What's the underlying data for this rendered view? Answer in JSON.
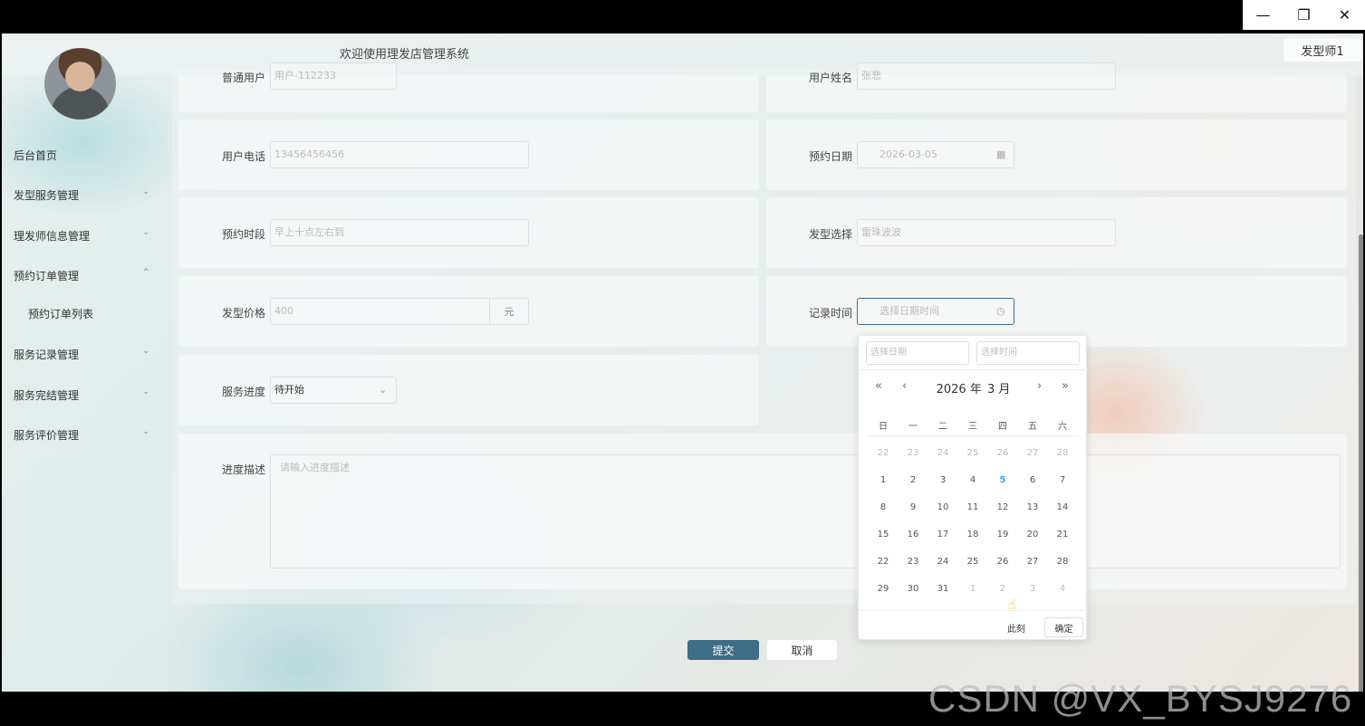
{
  "window": {
    "minimize": "—",
    "restore": "❐",
    "close": "✕"
  },
  "header": {
    "title": "欢迎使用理发店管理系统",
    "user_label": "发型师1"
  },
  "sidebar": {
    "items": [
      {
        "label": "后台首页",
        "chevron": ""
      },
      {
        "label": "发型服务管理",
        "chevron": "⌄"
      },
      {
        "label": "理发师信息管理",
        "chevron": "⌄"
      },
      {
        "label": "预约订单管理",
        "chevron": "^"
      },
      {
        "label": "服务记录管理",
        "chevron": "⌄"
      },
      {
        "label": "服务完结管理",
        "chevron": "⌄"
      },
      {
        "label": "服务评价管理",
        "chevron": "⌄"
      }
    ],
    "subitems": [
      {
        "label": "预约订单列表"
      }
    ]
  },
  "form": {
    "account": {
      "label": "普通用户",
      "value": "用户-112233"
    },
    "name": {
      "label": "用户姓名",
      "value": "张悲"
    },
    "phone": {
      "label": "用户电话",
      "value": "13456456456"
    },
    "date": {
      "label": "预约日期",
      "value": "2026-03-05"
    },
    "slot": {
      "label": "预约时段",
      "value": "早上十点左右到"
    },
    "style": {
      "label": "发型选择",
      "value": "雷珠波波"
    },
    "price": {
      "label": "发型价格",
      "value": "400",
      "unit": "元"
    },
    "record_time": {
      "label": "记录时间",
      "placeholder": "选择日期时间"
    },
    "progress": {
      "label": "服务进度",
      "value": "待开始"
    },
    "desc": {
      "label": "进度描述",
      "placeholder": "请输入进度描述"
    }
  },
  "buttons": {
    "submit": "提交",
    "cancel": "取消"
  },
  "picker": {
    "date_placeholder": "选择日期",
    "time_placeholder": "选择时间",
    "nav": {
      "prev_year": "«",
      "prev_month": "‹",
      "next_month": "›",
      "next_year": "»"
    },
    "year": "2026 年",
    "month": "3 月",
    "weekdays": [
      "日",
      "一",
      "二",
      "三",
      "四",
      "五",
      "六"
    ],
    "weeks": [
      [
        [
          "22",
          "muted"
        ],
        [
          "23",
          "muted"
        ],
        [
          "24",
          "muted"
        ],
        [
          "25",
          "muted"
        ],
        [
          "26",
          "muted"
        ],
        [
          "27",
          "muted"
        ],
        [
          "28",
          "muted"
        ]
      ],
      [
        [
          "1",
          ""
        ],
        [
          "2",
          ""
        ],
        [
          "3",
          ""
        ],
        [
          "4",
          ""
        ],
        [
          "5",
          "today"
        ],
        [
          "6",
          ""
        ],
        [
          "7",
          ""
        ]
      ],
      [
        [
          "8",
          ""
        ],
        [
          "9",
          ""
        ],
        [
          "10",
          ""
        ],
        [
          "11",
          ""
        ],
        [
          "12",
          ""
        ],
        [
          "13",
          ""
        ],
        [
          "14",
          ""
        ]
      ],
      [
        [
          "15",
          ""
        ],
        [
          "16",
          ""
        ],
        [
          "17",
          ""
        ],
        [
          "18",
          ""
        ],
        [
          "19",
          ""
        ],
        [
          "20",
          ""
        ],
        [
          "21",
          ""
        ]
      ],
      [
        [
          "22",
          ""
        ],
        [
          "23",
          ""
        ],
        [
          "24",
          ""
        ],
        [
          "25",
          ""
        ],
        [
          "26",
          ""
        ],
        [
          "27",
          ""
        ],
        [
          "28",
          ""
        ]
      ],
      [
        [
          "29",
          ""
        ],
        [
          "30",
          ""
        ],
        [
          "31",
          ""
        ],
        [
          "1",
          "muted"
        ],
        [
          "2",
          "muted"
        ],
        [
          "3",
          "muted"
        ],
        [
          "4",
          "muted"
        ]
      ]
    ],
    "now_label": "此刻",
    "ok_label": "确定"
  },
  "watermark": "CSDN @VX_BYSJ9276"
}
